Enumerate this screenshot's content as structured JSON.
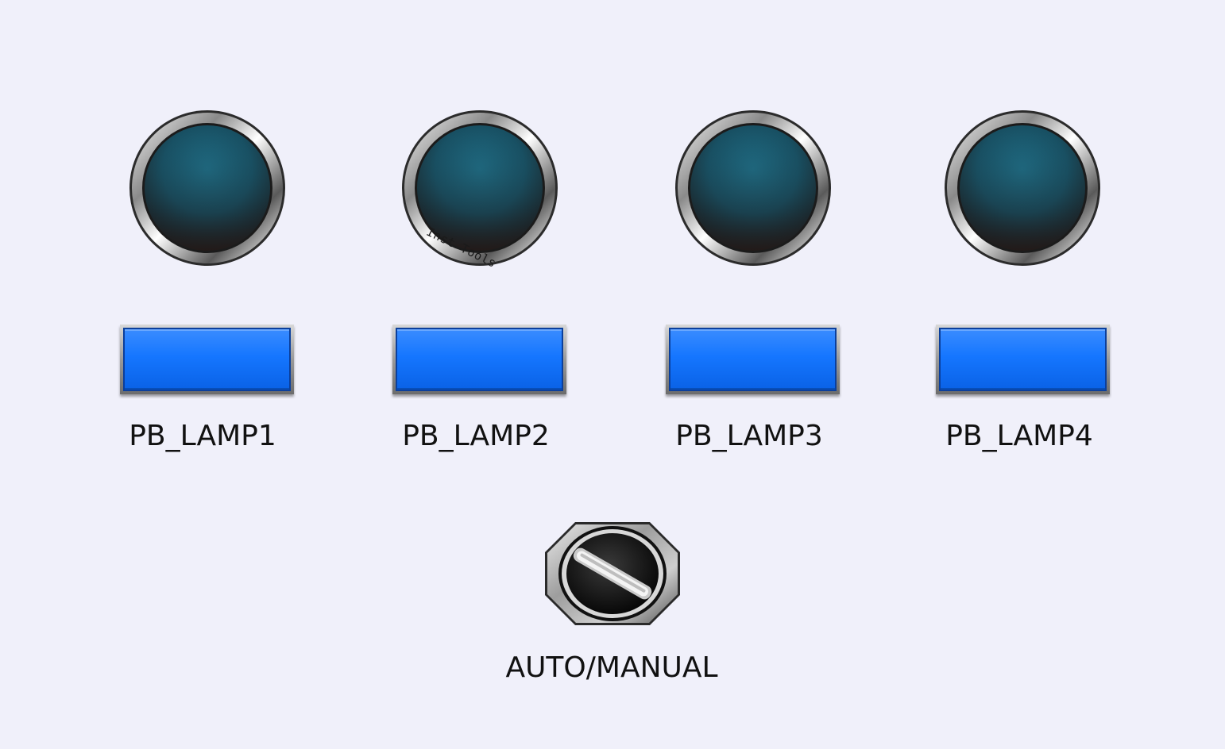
{
  "watermark": "Inst Tools",
  "lamps": [
    {
      "name": "lamp-1",
      "state": "off",
      "color": "#1d5f73"
    },
    {
      "name": "lamp-2",
      "state": "off",
      "color": "#1d5f73"
    },
    {
      "name": "lamp-3",
      "state": "off",
      "color": "#1d5f73"
    },
    {
      "name": "lamp-4",
      "state": "off",
      "color": "#1d5f73"
    }
  ],
  "pushbuttons": [
    {
      "label": "PB_LAMP1",
      "color": "#1576ff"
    },
    {
      "label": "PB_LAMP2",
      "color": "#1576ff"
    },
    {
      "label": "PB_LAMP3",
      "color": "#1576ff"
    },
    {
      "label": "PB_LAMP4",
      "color": "#1576ff"
    }
  ],
  "selector_switch": {
    "label": "AUTO/MANUAL",
    "icon": "selector-switch-icon"
  },
  "colors": {
    "background": "#f0f0fa",
    "lamp_off": "#1d5f73",
    "button_blue": "#1576ff"
  }
}
